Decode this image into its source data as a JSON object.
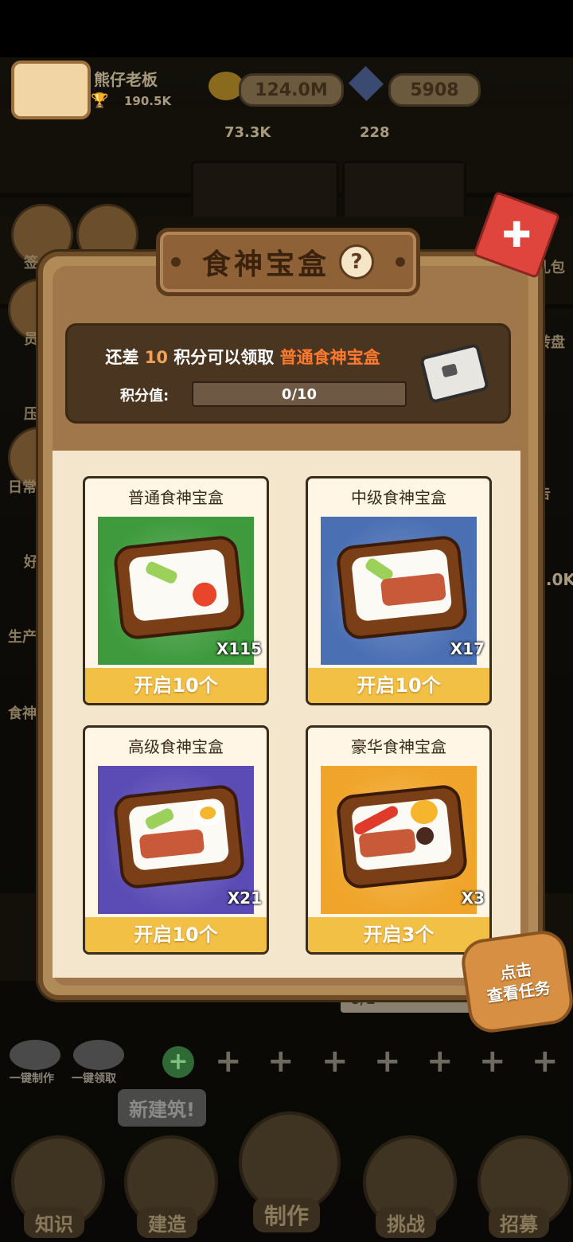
{
  "hud": {
    "player_name": "熊仔老板",
    "trophy_value": "190.5K",
    "coins": "124.0M",
    "gems": "5908",
    "floor_value_1": "73.3K",
    "floor_value_2": "228",
    "side_partial_value": "7.0K"
  },
  "left_menu": [
    "签",
    "员",
    "压",
    "日常",
    "好",
    "生产",
    "食神"
  ],
  "right_menu": [
    "礼包",
    "转盘",
    "告"
  ],
  "background_progress": "0/1",
  "bottom": {
    "quick_make": "一键制作",
    "quick_collect": "一键领取",
    "new_building_tip": "新建筑!",
    "nav": [
      "知识",
      "建造",
      "制作",
      "挑战",
      "招募"
    ]
  },
  "modal": {
    "title": "食神宝盒",
    "help_symbol": "?",
    "close_symbol": "✚",
    "progress_prefix": "还差",
    "progress_points": "10",
    "progress_middle": "积分可以领取",
    "progress_target": "普通食神宝盒",
    "score_label": "积分值:",
    "score_text": "0/10",
    "score_fraction": 0,
    "cards": [
      {
        "name": "普通食神宝盒",
        "count": "X115",
        "button": "开启10个",
        "bg": "#3e9a3c"
      },
      {
        "name": "中级食神宝盒",
        "count": "X17",
        "button": "开启10个",
        "bg": "#4a6fb3"
      },
      {
        "name": "高级食神宝盒",
        "count": "X21",
        "button": "开启10个",
        "bg": "#5a4bb5"
      },
      {
        "name": "豪华食神宝盒",
        "count": "X3",
        "button": "开启3个",
        "bg": "#f0a52a"
      }
    ],
    "task_badge_line1": "点击",
    "task_badge_line2": "查看任务"
  }
}
